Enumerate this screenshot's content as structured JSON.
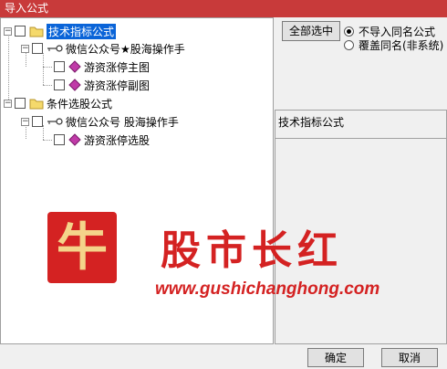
{
  "window": {
    "title": "导入公式"
  },
  "tree": {
    "nodes": [
      {
        "label": "技术指标公式",
        "selected": true
      },
      {
        "label": "微信公众号★股海操作手"
      },
      {
        "label": "游资涨停主图"
      },
      {
        "label": "游资涨停副图"
      },
      {
        "label": "条件选股公式"
      },
      {
        "label": "微信公众号 股海操作手"
      },
      {
        "label": "游资涨停选股"
      }
    ]
  },
  "options": {
    "select_all": "全部选中",
    "radios": [
      {
        "label": "不导入同名公式",
        "checked": true
      },
      {
        "label": "覆盖同名(非系统)",
        "checked": false
      }
    ]
  },
  "info": {
    "title": "技术指标公式"
  },
  "buttons": {
    "ok": "确定",
    "cancel": "取消"
  },
  "watermark": {
    "logo_char": "牛",
    "brand": "股市长红",
    "url": "www.gushichanghong.com"
  },
  "colors": {
    "titlebar": "#c83a3a",
    "watermark": "#d42222",
    "selection": "#0a64d8"
  }
}
